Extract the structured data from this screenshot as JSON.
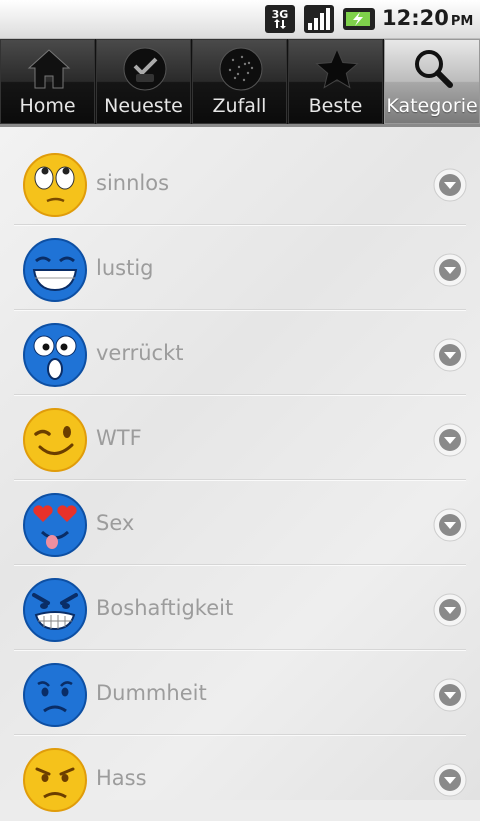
{
  "status_bar": {
    "network": "3G",
    "time": "12:20",
    "ampm": "PM"
  },
  "tabs": [
    {
      "label": "Home",
      "icon": "home-icon",
      "active": false
    },
    {
      "label": "Neueste",
      "icon": "new-badge-icon",
      "active": false
    },
    {
      "label": "Zufall",
      "icon": "random-dots-icon",
      "active": false
    },
    {
      "label": "Beste",
      "icon": "star-icon",
      "active": false
    },
    {
      "label": "Kategorie",
      "icon": "search-icon",
      "active": true
    }
  ],
  "categories": [
    {
      "label": "sinnlos",
      "icon": "rolling-eyes-smiley-icon"
    },
    {
      "label": "lustig",
      "icon": "laughing-smiley-icon"
    },
    {
      "label": "verrückt",
      "icon": "crazy-smiley-icon"
    },
    {
      "label": "WTF",
      "icon": "winking-smiley-icon"
    },
    {
      "label": "Sex",
      "icon": "heart-eyes-smiley-icon"
    },
    {
      "label": "Boshaftigkeit",
      "icon": "evil-grin-smiley-icon"
    },
    {
      "label": "Dummheit",
      "icon": "sad-smiley-icon"
    },
    {
      "label": "Hass",
      "icon": "angry-smiley-icon"
    }
  ],
  "colors": {
    "blue_smiley": "#1f73d6",
    "yellow_smiley": "#f5c21b",
    "label_text": "#9c9c9c",
    "active_tab": "#bcbcbc"
  }
}
